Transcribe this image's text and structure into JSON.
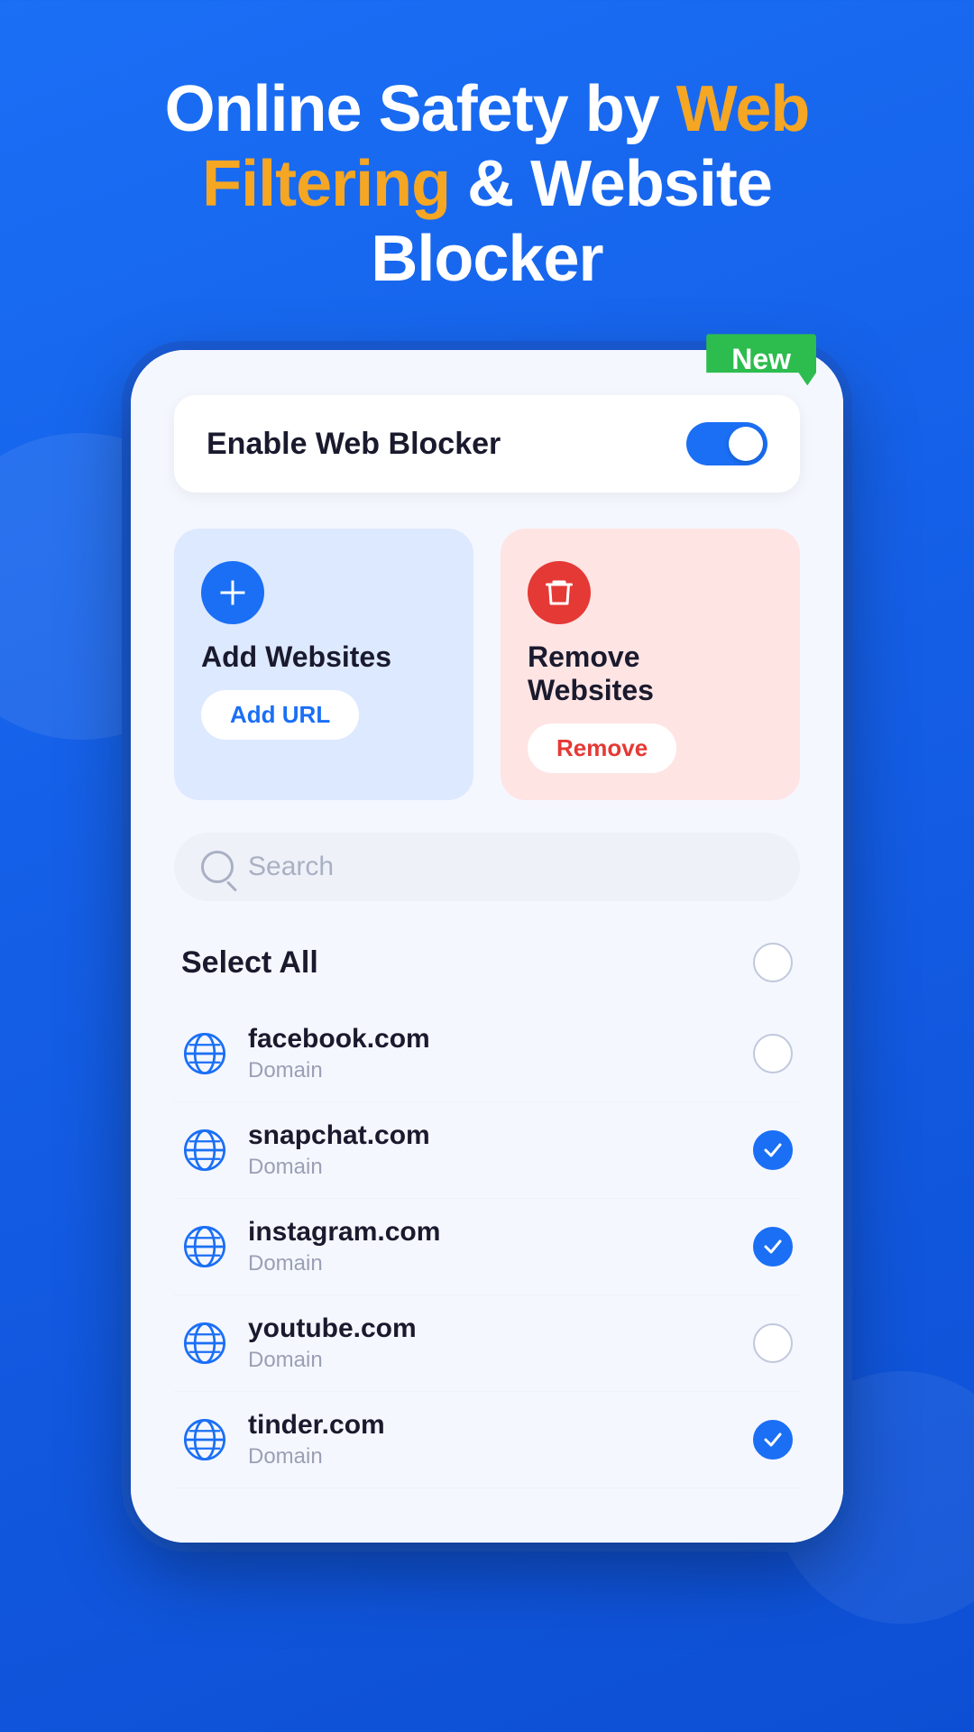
{
  "header": {
    "line1_white": "Online Safety by",
    "line1_highlight": "Web",
    "line2_highlight": "Filtering",
    "line2_white": "& Website",
    "line3_white": "Blocker"
  },
  "new_badge": "New",
  "enable_row": {
    "label": "Enable Web Blocker",
    "toggle_on": true
  },
  "add_card": {
    "title": "Add Websites",
    "button_label": "Add URL"
  },
  "remove_card": {
    "title": "Remove Websites",
    "button_label": "Remove"
  },
  "search": {
    "placeholder": "Search"
  },
  "select_all": {
    "label": "Select All",
    "checked": false
  },
  "websites": [
    {
      "name": "facebook.com",
      "type": "Domain",
      "checked": false
    },
    {
      "name": "snapchat.com",
      "type": "Domain",
      "checked": true
    },
    {
      "name": "instagram.com",
      "type": "Domain",
      "checked": true
    },
    {
      "name": "youtube.com",
      "type": "Domain",
      "checked": false
    },
    {
      "name": "tinder.com",
      "type": "Domain",
      "checked": true
    }
  ],
  "colors": {
    "blue": "#1a6ff5",
    "orange": "#f5a623",
    "green": "#2dbc4e",
    "red": "#e53935"
  }
}
